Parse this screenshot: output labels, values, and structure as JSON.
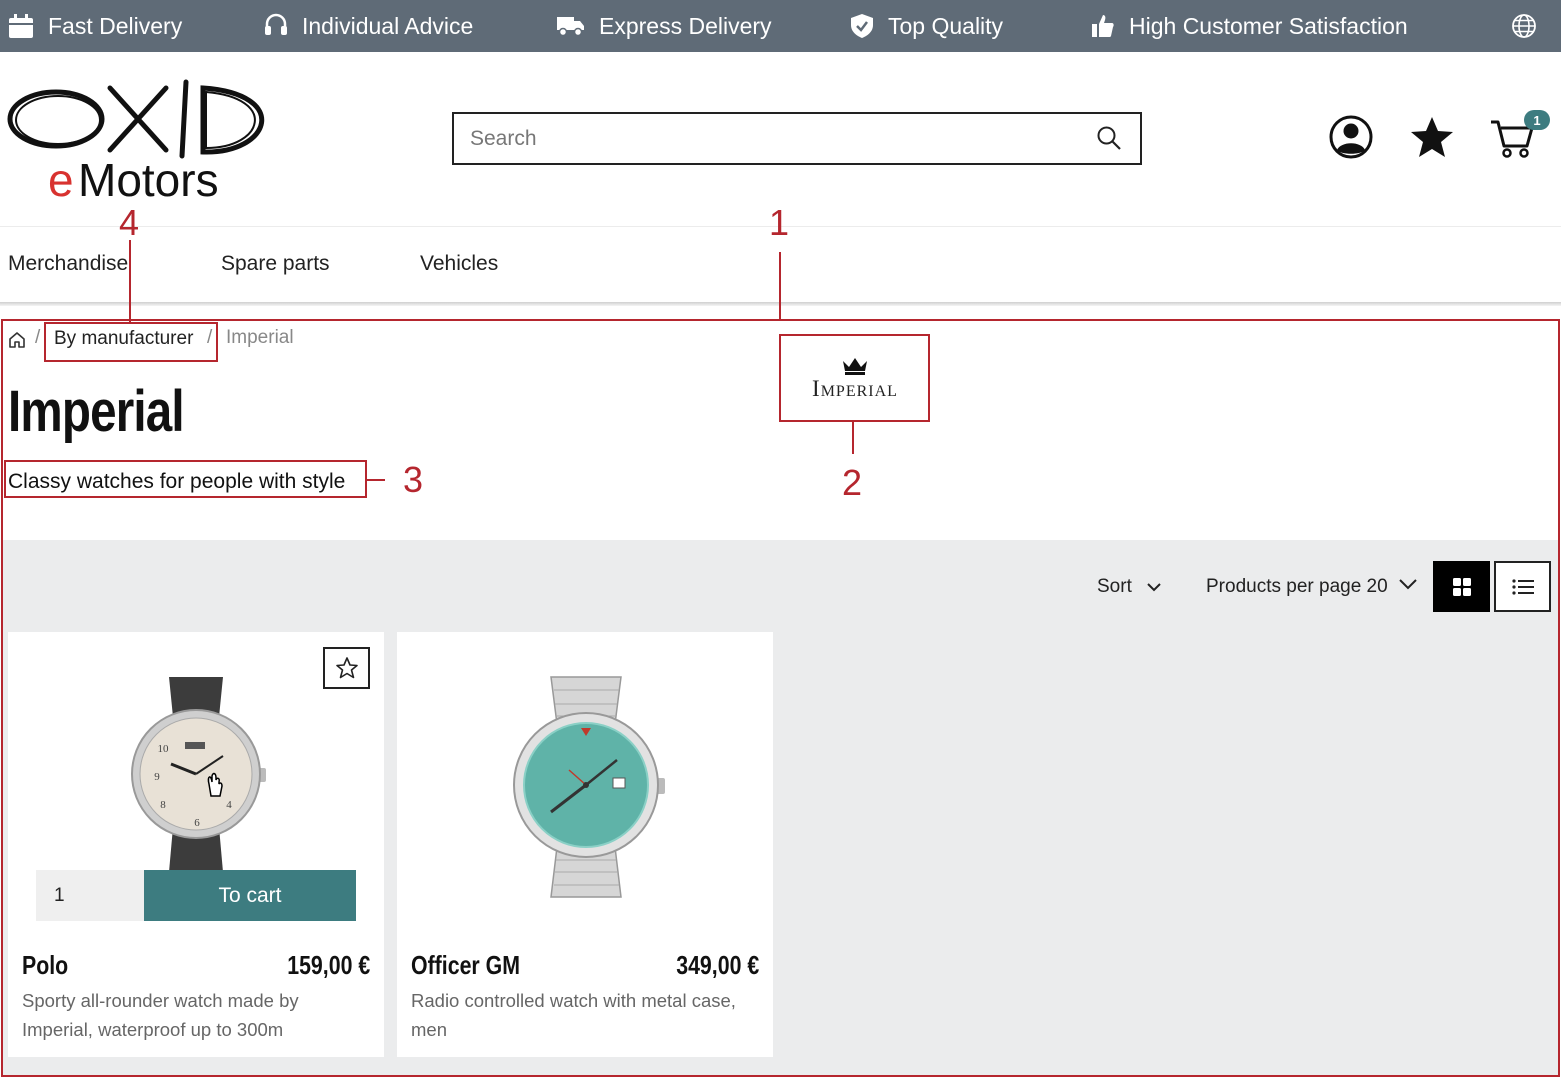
{
  "topbar": {
    "items": [
      {
        "label": "Fast Delivery",
        "icon": "calendar-icon"
      },
      {
        "label": "Individual Advice",
        "icon": "headset-icon"
      },
      {
        "label": "Express Delivery",
        "icon": "truck-icon"
      },
      {
        "label": "Top Quality",
        "icon": "shield-check-icon"
      },
      {
        "label": "High Customer Satisfaction",
        "icon": "thumbs-up-icon"
      }
    ],
    "language_icon": "globe-icon"
  },
  "header": {
    "logo_line1": "OXID",
    "logo_line2": "eMotors",
    "search_placeholder": "Search",
    "cart_count": "1"
  },
  "nav": {
    "items": [
      "Merchandise",
      "Spare parts",
      "Vehicles"
    ]
  },
  "breadcrumb": {
    "separator": "/",
    "link": "By manufacturer",
    "current": "Imperial"
  },
  "page": {
    "title": "Imperial",
    "description": "Classy watches for people with style",
    "brand_logo_text": "Imperial"
  },
  "annotations": [
    "1",
    "2",
    "3",
    "4"
  ],
  "toolbar": {
    "sort_label": "Sort",
    "per_page_label": "Products per page 20"
  },
  "products": [
    {
      "name": "Polo",
      "price": "159,00 €",
      "description": "Sporty all-rounder watch made by Imperial, waterproof up to 300m",
      "qty": "1",
      "cart_label": "To cart"
    },
    {
      "name": "Officer GM",
      "price": "349,00 €",
      "description": "Radio controlled watch with metal case, men"
    }
  ],
  "colors": {
    "topbar": "#5f6b77",
    "accent": "#3d7c80",
    "annotation": "#b5262e"
  }
}
